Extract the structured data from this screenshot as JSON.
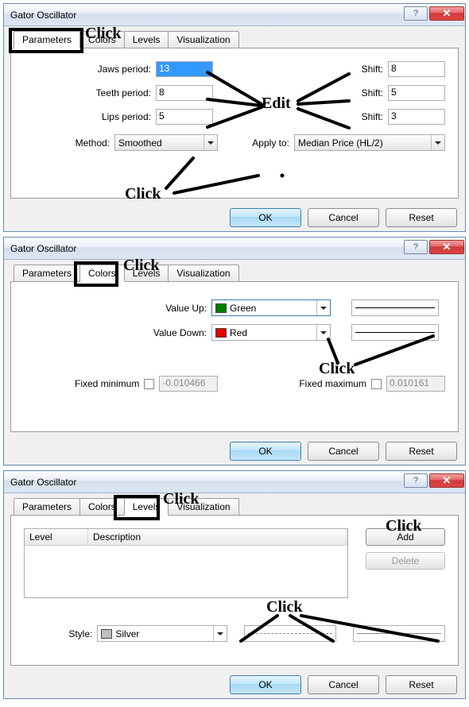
{
  "dialogs": [
    {
      "title": "Gator Oscillator",
      "tabs": [
        "Parameters",
        "Colors",
        "Levels",
        "Visualization"
      ],
      "active_tab": 0,
      "params": {
        "jaws_label": "Jaws period:",
        "jaws_value": "13",
        "teeth_label": "Teeth period:",
        "teeth_value": "8",
        "lips_label": "Lips period:",
        "lips_value": "5",
        "shift_label": "Shift:",
        "shift_jaws": "8",
        "shift_teeth": "5",
        "shift_lips": "3",
        "method_label": "Method:",
        "method_value": "Smoothed",
        "apply_label": "Apply to:",
        "apply_value": "Median Price (HL/2)"
      },
      "annot": {
        "click_top": "Click",
        "edit": "Edit",
        "click_bottom": "Click"
      }
    },
    {
      "title": "Gator Oscillator",
      "tabs": [
        "Parameters",
        "Colors",
        "Levels",
        "Visualization"
      ],
      "active_tab": 1,
      "colors": {
        "up_label": "Value Up:",
        "up_color": "Green",
        "up_hex": "#008000",
        "down_label": "Value Down:",
        "down_color": "Red",
        "down_hex": "#e00000",
        "fixed_min_label": "Fixed minimum",
        "fixed_min_value": "-0.010466",
        "fixed_max_label": "Fixed maximum",
        "fixed_max_value": "0.010161"
      },
      "annot": {
        "click_top": "Click",
        "click_mid": "Click"
      }
    },
    {
      "title": "Gator Oscillator",
      "tabs": [
        "Parameters",
        "Colors",
        "Levels",
        "Visualization"
      ],
      "active_tab": 2,
      "levels": {
        "col_level": "Level",
        "col_desc": "Description",
        "add": "Add",
        "delete": "Delete",
        "style_label": "Style:",
        "style_value": "Silver",
        "style_hex": "#c0c0c0"
      },
      "annot": {
        "click_top": "Click",
        "click_add": "Click",
        "click_style": "Click"
      }
    }
  ],
  "common": {
    "ok": "OK",
    "cancel": "Cancel",
    "reset": "Reset",
    "help_glyph": "?",
    "close_glyph": "✕"
  }
}
